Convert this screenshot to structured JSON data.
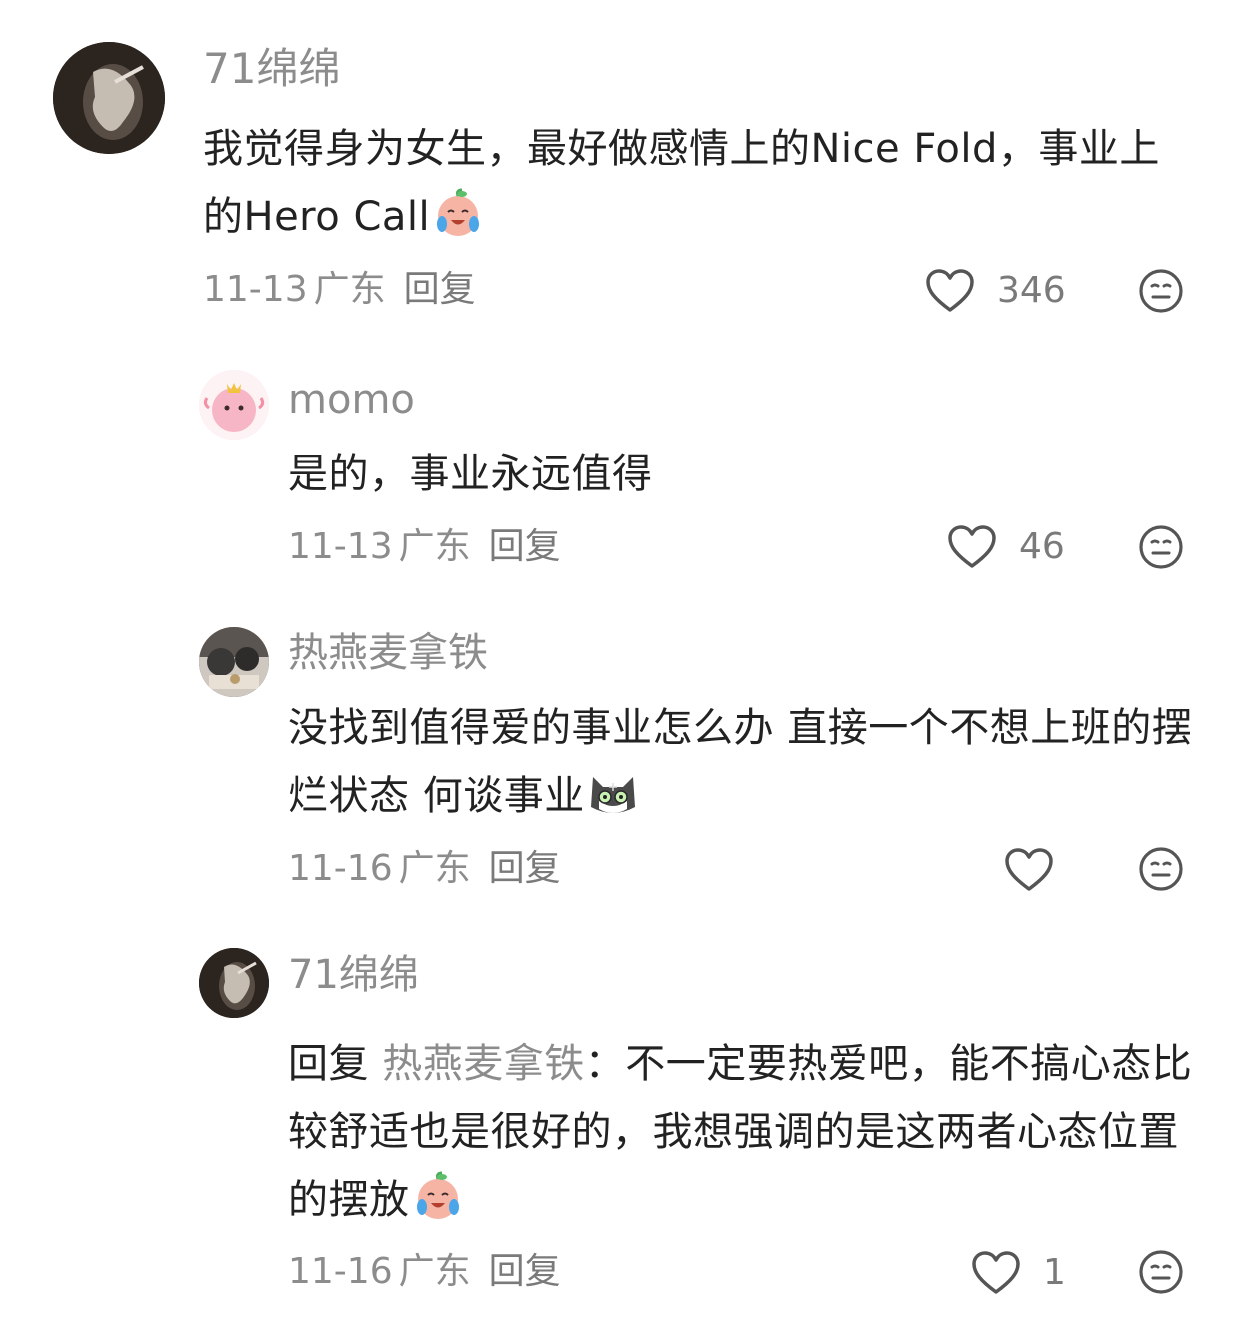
{
  "comments": [
    {
      "username": "71绵绵",
      "text": "我觉得身为女生，最好做感情上的Nice Fold，事业上的Hero Call",
      "emoji": "crying-laughing-face-emoji",
      "date": "11-13",
      "location": "广东",
      "reply_label": "回复",
      "like_count": "346"
    },
    {
      "username": "momo",
      "text": "是的，事业永远值得",
      "date": "11-13",
      "location": "广东",
      "reply_label": "回复",
      "like_count": "46"
    },
    {
      "username": "热燕麦拿铁",
      "text": "没找到值得爱的事业怎么办 直接一个不想上班的摆烂状态 何谈事业",
      "emoji": "cat-emoji",
      "date": "11-16",
      "location": "广东",
      "reply_label": "回复",
      "like_count": ""
    },
    {
      "username": "71绵绵",
      "reply_prefix": "回复",
      "reply_to": "热燕麦拿铁",
      "text": "：不一定要热爱吧，能不搞心态比较舒适也是很好的，我想强调的是这两者心态位置的摆放",
      "emoji": "crying-laughing-face-emoji",
      "date": "11-16",
      "location": "广东",
      "reply_label": "回复",
      "like_count": "1"
    }
  ],
  "colors": {
    "text": "#222222",
    "secondary": "#8c8c8c",
    "icon": "#555555"
  }
}
